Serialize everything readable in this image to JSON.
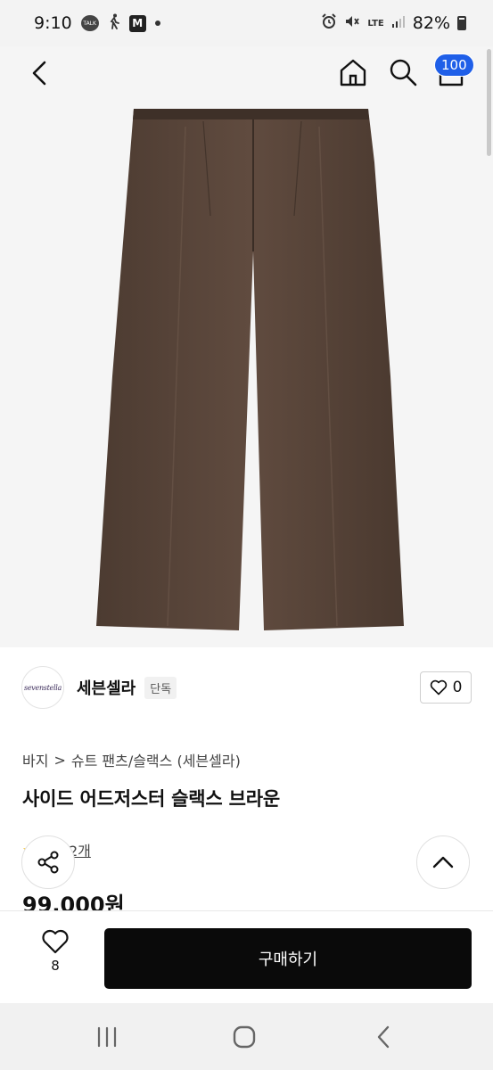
{
  "status_bar": {
    "time": "9:10",
    "talk_label": "TALK",
    "m_label": "M",
    "lte_label": "LTE",
    "battery": "82%"
  },
  "nav": {
    "cart_count": "100"
  },
  "product_image": {
    "color": "#5a463b"
  },
  "brand": {
    "logo_text": "sevenstella",
    "name": "세븐셀라",
    "tag": "단독",
    "like_count": "0"
  },
  "breadcrumb": {
    "category": "바지",
    "separator": ">",
    "subcategory": "슈트 팬츠/슬랙스 (세븐셀라)"
  },
  "product": {
    "title": "사이드 어드저스터 슬랙스 브라운",
    "review_text": "후기 2개",
    "price": "99,000원"
  },
  "bottom_bar": {
    "wish_count": "8",
    "buy_label": "구매하기"
  },
  "colors": {
    "accent": "#1f5fe8",
    "buy_button": "#0a0a0a"
  }
}
